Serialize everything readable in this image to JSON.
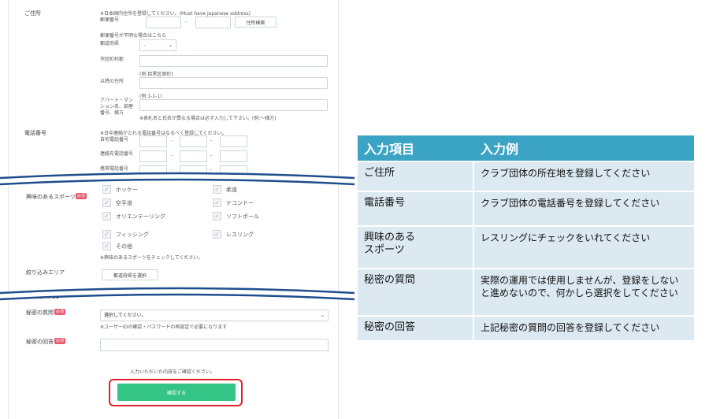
{
  "form": {
    "address": {
      "label": "ご住所",
      "note": "※日本国内住所を登録してください。(Must have Japanese address)",
      "postal_label": "郵便番号",
      "postal_dash": "-",
      "address_search_button": "住所検索",
      "postal_unknown_link": "郵便番号が不明な場合はこちら",
      "prefecture_label": "都道府県",
      "prefecture_value": "-",
      "city_label": "市区町村郡",
      "city_example": "(例:目黒区原町)",
      "street_label": "以降の住所",
      "street_example": "(例:1-1-1)",
      "apartment_label": "アパート・マンション名、部屋番号、様方",
      "apartment_note": "※表札名と氏名が異なる場合は必ず入力して下さい。(例:～様方)"
    },
    "phone": {
      "label": "電話番号",
      "note": "※日中連絡がとれる電話番号はなるべく登録してください。",
      "home_label": "自宅電話番号",
      "contact_label": "連絡先電話番号",
      "mobile_label": "携帯電話番号",
      "dash": "-"
    },
    "sports": {
      "label": "興味のあるスポーツ",
      "required_badge": "必須",
      "options": [
        "ホッケー",
        "柔道",
        "空手道",
        "テコンドー",
        "オリエンテーリング",
        "ソフトボール",
        "フィッシング",
        "レスリング",
        "その他"
      ],
      "note": "※興味のあるスポーツをチェックしてください。"
    },
    "area": {
      "label": "絞り込みエリア",
      "button": "都道府県を選択"
    },
    "other_section_title": "その他の入力",
    "secret_question": {
      "label": "秘密の質問",
      "required_badge": "必須",
      "select_value": "選択してください。",
      "note": "※ユーザーIDの確認・パスワードの再設定で必要になります"
    },
    "secret_answer": {
      "label": "秘密の回答",
      "required_badge": "必須"
    },
    "confirm_note": "入力いただいた内容をご確認ください。",
    "confirm_button": "確認する"
  },
  "help_table": {
    "headers": [
      "入力項目",
      "入力例"
    ],
    "rows": [
      {
        "item": "ご住所",
        "example": "クラブ団体の所在地を登録してください"
      },
      {
        "item": "電話番号",
        "example": "クラブ団体の電話番号を登録してください"
      },
      {
        "item": "興味のある\nスポーツ",
        "example": "レスリングにチェックをいれてください"
      },
      {
        "item": "秘密の質問",
        "example": "実際の運用では使用しませんが、登録をしないと進めないので、何かしら選択をしてください"
      },
      {
        "item": "秘密の回答",
        "example": "上記秘密の質問の回答を登録してください"
      }
    ]
  },
  "colors": {
    "accent_green": "#33c486",
    "highlight_red": "#e0202a",
    "table_header": "#3ba3c4",
    "table_cell": "#dce9f1",
    "wave_line": "#1f4e8c",
    "required_badge": "#e8596f"
  }
}
